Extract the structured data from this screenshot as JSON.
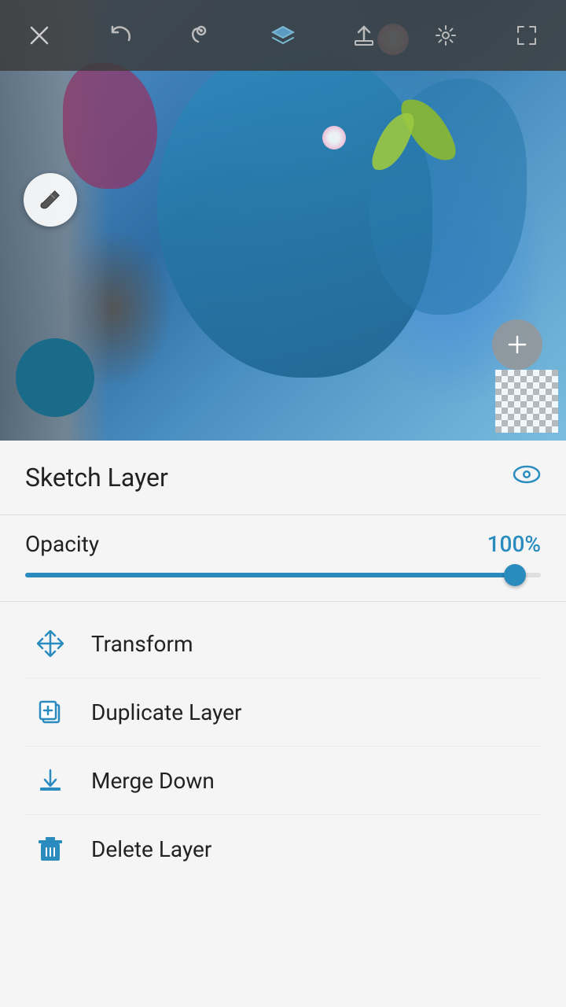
{
  "toolbar": {
    "close_label": "×",
    "undo_label": "↩",
    "redo_label": "↺",
    "layers_label": "⬡",
    "export_label": "↑",
    "settings_label": "⚙",
    "expand_label": "⤢"
  },
  "layer": {
    "title": "Sketch Layer",
    "visibility_icon": "eye-icon"
  },
  "opacity": {
    "label": "Opacity",
    "value": "100%",
    "percent": 100
  },
  "menu": {
    "items": [
      {
        "id": "transform",
        "label": "Transform",
        "icon": "move-icon"
      },
      {
        "id": "duplicate",
        "label": "Duplicate Layer",
        "icon": "duplicate-icon"
      },
      {
        "id": "merge",
        "label": "Merge Down",
        "icon": "merge-icon"
      },
      {
        "id": "delete",
        "label": "Delete Layer",
        "icon": "delete-icon"
      }
    ]
  },
  "canvas": {
    "add_button_label": "+"
  },
  "colors": {
    "accent": "#2a8bbf",
    "text_primary": "#222222",
    "panel_bg": "#f5f5f5",
    "divider": "#e0e0e0"
  }
}
